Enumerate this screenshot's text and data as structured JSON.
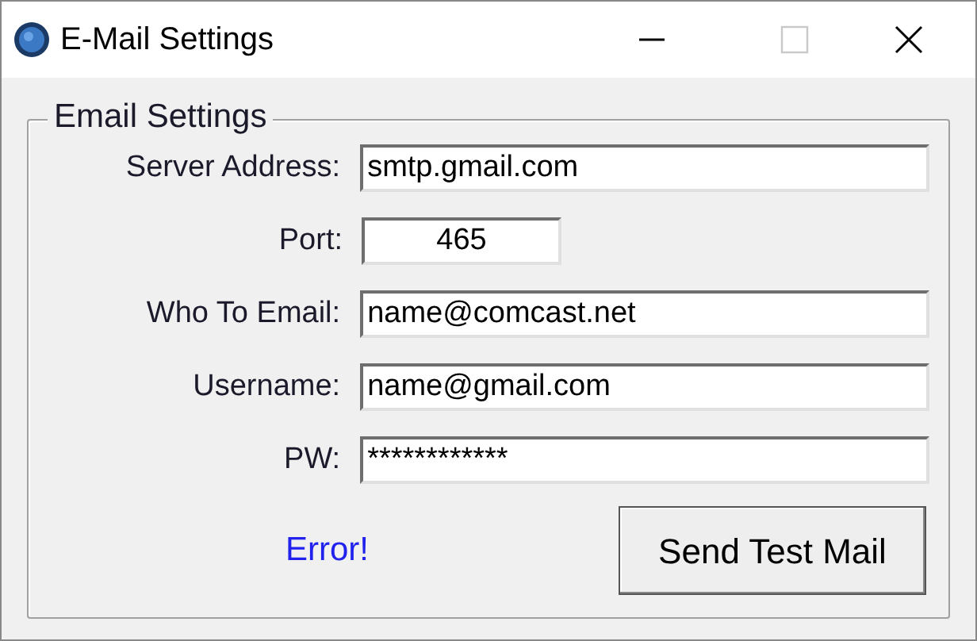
{
  "window": {
    "title": "E-Mail Settings",
    "maximize_disabled": true
  },
  "group": {
    "title": "Email Settings"
  },
  "fields": [
    {
      "label": "Server Address:",
      "value": "smtp.gmail.com",
      "kind": "wide"
    },
    {
      "label": "Port:",
      "value": "465",
      "kind": "narrow"
    },
    {
      "label": "Who To Email:",
      "value": "name@comcast.net",
      "kind": "wide"
    },
    {
      "label": "Username:",
      "value": "name@gmail.com",
      "kind": "wide"
    },
    {
      "label": "PW:",
      "value": "************",
      "kind": "wide"
    }
  ],
  "status": "Error!",
  "button": "Send Test Mail"
}
